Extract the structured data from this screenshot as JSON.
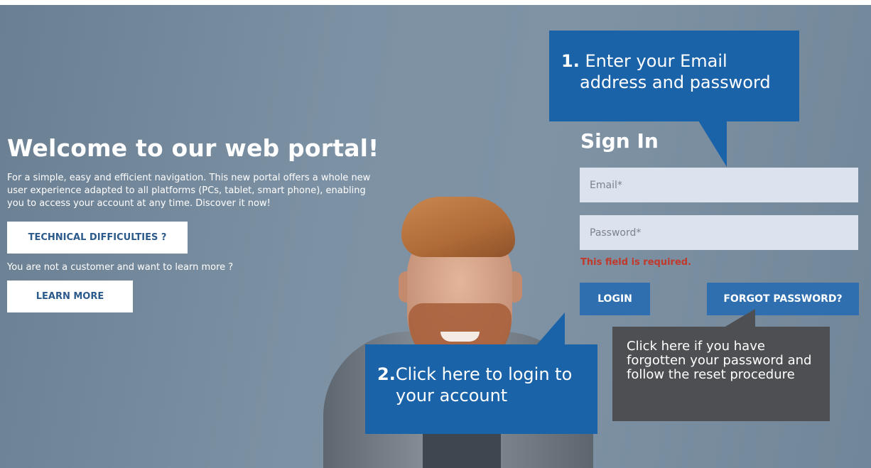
{
  "welcome": {
    "title": "Welcome to our web portal!",
    "intro": "For a simple, easy and efficient navigation. This new portal offers a whole new user experience adapted to all platforms (PCs, tablet, smart phone), enabling you to access your account at any time. Discover it now!",
    "technical_button": "TECHNICAL DIFFICULTIES ?",
    "prompt": "You are not a customer and want to learn more ?",
    "learn_button": "LEARN MORE"
  },
  "signin": {
    "title": "Sign In",
    "email_placeholder": "Email*",
    "password_placeholder": "Password*",
    "error": "This field is required.",
    "login_button": "LOGIN",
    "forgot_button": "FORGOT PASSWORD?"
  },
  "callouts": {
    "step1_number": "1.",
    "step1_line1": " Enter your Email",
    "step1_line2": "address and password",
    "step2_number": "2.",
    "step2_line1": "Click here to login to",
    "step2_line2": "your account",
    "forgot_help": "Click here if you have forgotten your password and follow the reset procedure"
  },
  "colors": {
    "callout_blue": "#1b63a8",
    "callout_gray": "#4e4f52",
    "button_blue": "#2f6fb0",
    "error_red": "#c0392b"
  }
}
